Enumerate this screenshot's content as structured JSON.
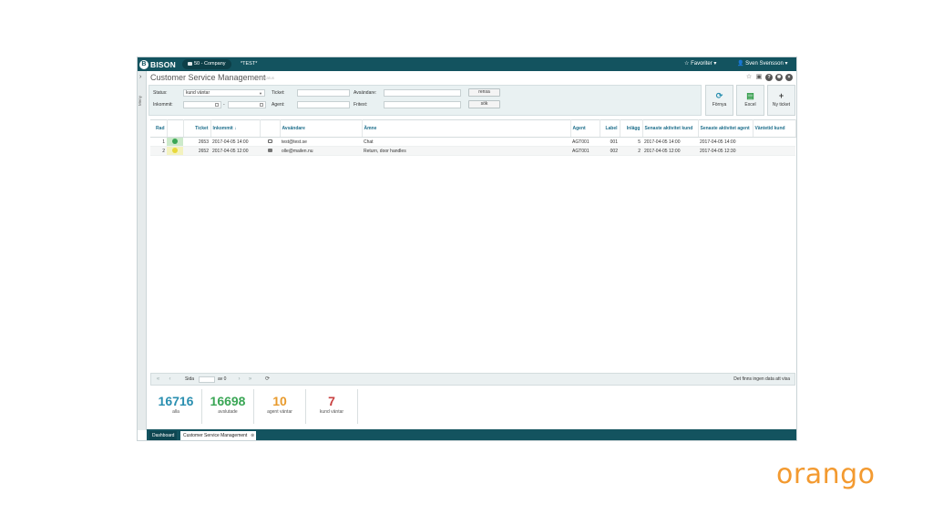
{
  "topbar": {
    "logo_mark": "B",
    "logo_text": "BISON",
    "company": "50 - Company",
    "environment": "*TEST*",
    "favorites": "Favoriter",
    "favorites_icon": "star-icon",
    "user": "Sven Svensson",
    "user_icon": "user-icon",
    "caret": "▾"
  },
  "sidebar": {
    "toggle": "›",
    "label": "Meny"
  },
  "header": {
    "title": "Customer Service Management",
    "subtitle": "status",
    "icons": [
      "star-icon",
      "save-icon",
      "help-icon",
      "settings-icon",
      "close-icon"
    ]
  },
  "filters": {
    "status_label": "Status:",
    "status_value": "kund väntar",
    "incoming_label": "Inkommit:",
    "incoming_sep": "-",
    "ticket_label": "Ticket:",
    "agent_label": "Agent:",
    "sender_label": "Avsändare:",
    "freetext_label": "Fritext:",
    "clear_button": "rensa",
    "search_button": "sök"
  },
  "actions": {
    "refresh": "Förnya",
    "excel": "Excel",
    "new_ticket": "Ny ticket"
  },
  "table": {
    "headers": {
      "row": "Rad",
      "ticket": "Ticket",
      "incoming": "Inkommit ↓",
      "sender": "Avsändare",
      "subject": "Ämne",
      "agent": "Agent",
      "label": "Label",
      "posts": "Inlägg",
      "last_activity_customer": "Senaste aktivitet kund",
      "last_activity_agent": "Senaste aktivitet agent",
      "wait_customer": "Väntetid kund"
    },
    "rows": [
      {
        "row": "1",
        "status": "green",
        "ticket": "2653",
        "incoming": "2017-04-05 14:00",
        "channel": "chat-icon",
        "sender": "test@test.se",
        "subject": "Chat",
        "agent": "AGT001",
        "label": "001",
        "posts": "5",
        "last_customer": "2017-04-05 14:00",
        "last_agent": "2017-04-05 14:00",
        "wait": ""
      },
      {
        "row": "2",
        "status": "yellow",
        "ticket": "2652",
        "incoming": "2017-04-05 12:00",
        "channel": "mail-icon",
        "sender": "olle@mailen.nu",
        "subject": "Return, door handles",
        "agent": "AGT001",
        "label": "002",
        "posts": "2",
        "last_customer": "2017-04-05 12:00",
        "last_agent": "2017-04-05 12:30",
        "wait": ""
      }
    ]
  },
  "pager": {
    "page_label": "Sida",
    "of_label": "av 0",
    "empty_text": "Det finns ingen data att visa"
  },
  "stats": [
    {
      "value": "16716",
      "label": "alla",
      "color": "#2a8fb0"
    },
    {
      "value": "16698",
      "label": "avslutade",
      "color": "#3aa655"
    },
    {
      "value": "10",
      "label": "agent väntar",
      "color": "#e89a2c"
    },
    {
      "value": "7",
      "label": "kund väntar",
      "color": "#c94040"
    }
  ],
  "bottom_tabs": {
    "dashboard": "Dashboard",
    "current": "Customer Service Management",
    "close_icon": "⊗"
  },
  "brand": "orango",
  "colors": {
    "topbar": "#13535f",
    "header_text": "#1f6f8c",
    "brand": "#f39a30"
  }
}
